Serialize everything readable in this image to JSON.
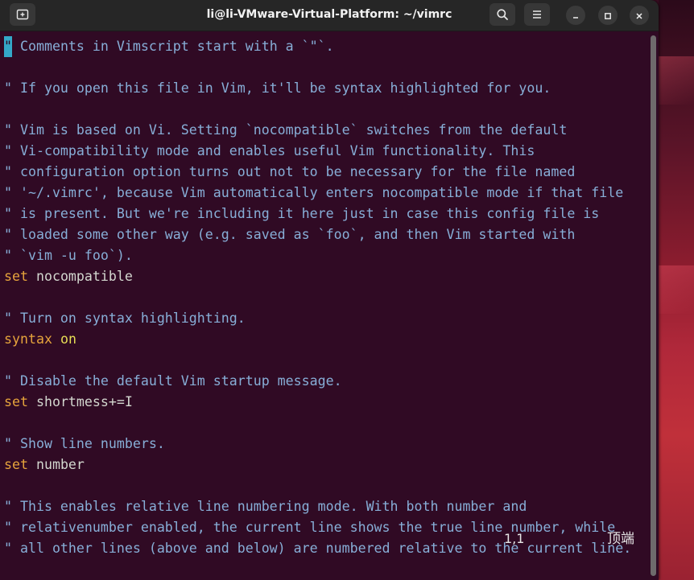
{
  "window": {
    "title": "li@li-VMware-Virtual-Platform: ~/vimrc",
    "new_tab_icon": "new-tab-icon",
    "search_icon": "search-icon",
    "menu_icon": "hamburger-menu-icon",
    "minimize_icon": "minimize-icon",
    "maximize_icon": "maximize-icon",
    "close_icon": "close-icon"
  },
  "editor": {
    "lines": [
      {
        "parts": [
          {
            "t": "\"",
            "c": "cursor"
          },
          {
            "t": " Comments in Vimscript start with a `\"`.",
            "c": "comment"
          }
        ]
      },
      {
        "parts": []
      },
      {
        "parts": [
          {
            "t": "\" If you open this file in Vim, it'll be syntax highlighted for you.",
            "c": "comment"
          }
        ]
      },
      {
        "parts": []
      },
      {
        "parts": [
          {
            "t": "\" Vim is based on Vi. Setting `nocompatible` switches from the default",
            "c": "comment"
          }
        ]
      },
      {
        "parts": [
          {
            "t": "\" Vi-compatibility mode and enables useful Vim functionality. This",
            "c": "comment"
          }
        ]
      },
      {
        "parts": [
          {
            "t": "\" configuration option turns out not to be necessary for the file named",
            "c": "comment"
          }
        ]
      },
      {
        "parts": [
          {
            "t": "\" '~/.vimrc', because Vim automatically enters nocompatible mode if that file",
            "c": "comment"
          }
        ]
      },
      {
        "parts": [
          {
            "t": "\" is present. But we're including it here just in case this config file is",
            "c": "comment"
          }
        ]
      },
      {
        "parts": [
          {
            "t": "\" loaded some other way (e.g. saved as `foo`, and then Vim started with",
            "c": "comment"
          }
        ]
      },
      {
        "parts": [
          {
            "t": "\" `vim -u foo`).",
            "c": "comment"
          }
        ]
      },
      {
        "parts": [
          {
            "t": "set",
            "c": "keyword"
          },
          {
            "t": " nocompatible",
            "c": "arg"
          }
        ]
      },
      {
        "parts": []
      },
      {
        "parts": [
          {
            "t": "\" Turn on syntax highlighting.",
            "c": "comment"
          }
        ]
      },
      {
        "parts": [
          {
            "t": "syntax",
            "c": "keyword"
          },
          {
            "t": " ",
            "c": "arg"
          },
          {
            "t": "on",
            "c": "option"
          }
        ]
      },
      {
        "parts": []
      },
      {
        "parts": [
          {
            "t": "\" Disable the default Vim startup message.",
            "c": "comment"
          }
        ]
      },
      {
        "parts": [
          {
            "t": "set",
            "c": "keyword"
          },
          {
            "t": " shortmess+=I",
            "c": "arg"
          }
        ]
      },
      {
        "parts": []
      },
      {
        "parts": [
          {
            "t": "\" Show line numbers.",
            "c": "comment"
          }
        ]
      },
      {
        "parts": [
          {
            "t": "set",
            "c": "keyword"
          },
          {
            "t": " number",
            "c": "arg"
          }
        ]
      },
      {
        "parts": []
      },
      {
        "parts": [
          {
            "t": "\" This enables relative line numbering mode. With both number and",
            "c": "comment"
          }
        ]
      },
      {
        "parts": [
          {
            "t": "\" relativenumber enabled, the current line shows the true line number, while",
            "c": "comment"
          }
        ]
      },
      {
        "parts": [
          {
            "t": "\" all other lines (above and below) are numbered relative to the current line.",
            "c": "comment"
          }
        ]
      }
    ],
    "colors": {
      "background": "#300a24",
      "comment": "#87aed7",
      "keyword": "#e6a43c",
      "option": "#e6dd55",
      "cursor": "#34a8c8"
    }
  },
  "status": {
    "position": "1,1",
    "scroll_indicator": "顶端"
  }
}
